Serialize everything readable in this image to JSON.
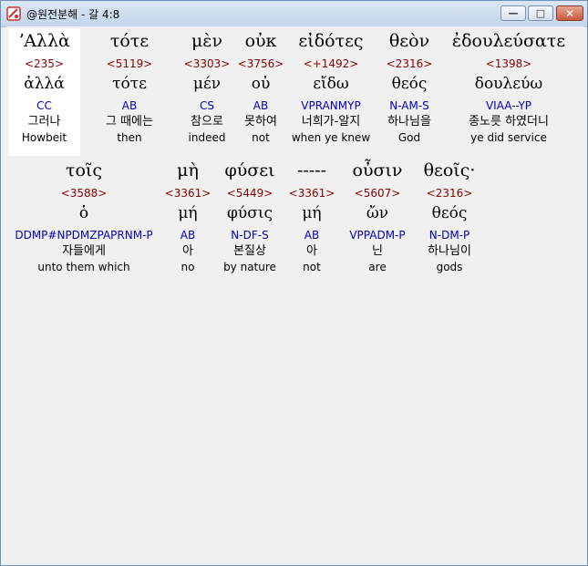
{
  "window": {
    "title": "@원전분해 - 갈 4:8",
    "minimize": "—",
    "maximize": "□",
    "close": "✕"
  },
  "rows": [
    [
      {
        "greek": "ʼΑλλὰ",
        "strong": "<235>",
        "lemma": "ἀλλά",
        "morph": "CC",
        "korean": "그러나",
        "english": "Howbeit"
      },
      {
        "greek": "τότε",
        "strong": "<5119>",
        "lemma": "τότε",
        "morph": "AB",
        "korean": "그 때에는",
        "english": "then"
      },
      {
        "greek": "μὲν",
        "strong": "<3303>",
        "lemma": "μέν",
        "morph": "CS",
        "korean": "참으로",
        "english": "indeed"
      },
      {
        "greek": "οὐκ",
        "strong": "<3756>",
        "lemma": "οὐ",
        "morph": "AB",
        "korean": "못하여",
        "english": "not"
      },
      {
        "greek": "εἰδότες",
        "strong": "<+1492>",
        "lemma": "εἴδω",
        "morph": "VPRANMYP",
        "korean": "너희가-알지",
        "english": "when ye knew"
      },
      {
        "greek": "θεὸν",
        "strong": "<2316>",
        "lemma": "θεός",
        "morph": "N-AM-S",
        "korean": "하나님을",
        "english": "God"
      },
      {
        "greek": "ἐδουλεύσατε",
        "strong": "<1398>",
        "lemma": "δουλεύω",
        "morph": "VIAA--YP",
        "korean": "종노릇 하였더니",
        "english": "ye did service"
      }
    ],
    [
      {
        "greek": "τοῖς",
        "strong": "<3588>",
        "lemma": "ὁ",
        "morph": "DDMP#NPDMZPAPRNM-P",
        "korean": "자들에게",
        "english": "unto them which"
      },
      {
        "greek": "μὴ",
        "strong": "<3361>",
        "lemma": "μή",
        "morph": "AB",
        "korean": "아",
        "english": "no"
      },
      {
        "greek": "φύσει",
        "strong": "<5449>",
        "lemma": "φύσις",
        "morph": "N-DF-S",
        "korean": "본질상",
        "english": "by nature"
      },
      {
        "greek": "-----",
        "strong": "<3361>",
        "lemma": "μή",
        "morph": "AB",
        "korean": "아",
        "english": "not"
      },
      {
        "greek": "οὖσιν",
        "strong": "<5607>",
        "lemma": "ὤν",
        "morph": "VPPADM-P",
        "korean": "닌",
        "english": "are"
      },
      {
        "greek": "θεοῖς·",
        "strong": "<2316>",
        "lemma": "θεός",
        "morph": "N-DM-P",
        "korean": "하나님이",
        "english": "gods"
      }
    ]
  ]
}
